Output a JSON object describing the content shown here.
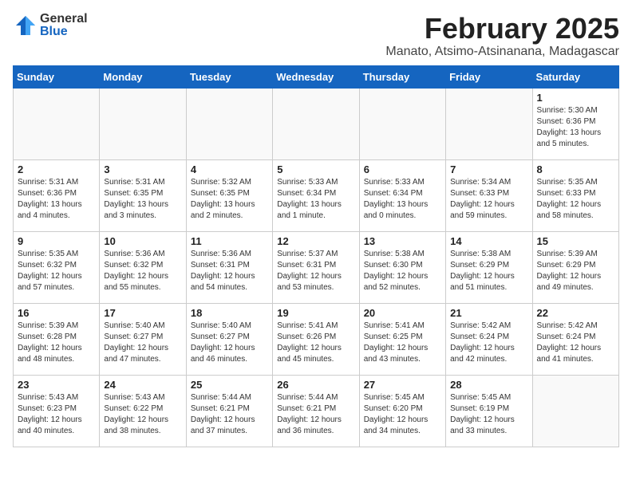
{
  "logo": {
    "general": "General",
    "blue": "Blue"
  },
  "title": "February 2025",
  "location": "Manato, Atsimo-Atsinanana, Madagascar",
  "weekdays": [
    "Sunday",
    "Monday",
    "Tuesday",
    "Wednesday",
    "Thursday",
    "Friday",
    "Saturday"
  ],
  "weeks": [
    [
      {
        "day": "",
        "info": ""
      },
      {
        "day": "",
        "info": ""
      },
      {
        "day": "",
        "info": ""
      },
      {
        "day": "",
        "info": ""
      },
      {
        "day": "",
        "info": ""
      },
      {
        "day": "",
        "info": ""
      },
      {
        "day": "1",
        "info": "Sunrise: 5:30 AM\nSunset: 6:36 PM\nDaylight: 13 hours\nand 5 minutes."
      }
    ],
    [
      {
        "day": "2",
        "info": "Sunrise: 5:31 AM\nSunset: 6:36 PM\nDaylight: 13 hours\nand 4 minutes."
      },
      {
        "day": "3",
        "info": "Sunrise: 5:31 AM\nSunset: 6:35 PM\nDaylight: 13 hours\nand 3 minutes."
      },
      {
        "day": "4",
        "info": "Sunrise: 5:32 AM\nSunset: 6:35 PM\nDaylight: 13 hours\nand 2 minutes."
      },
      {
        "day": "5",
        "info": "Sunrise: 5:33 AM\nSunset: 6:34 PM\nDaylight: 13 hours\nand 1 minute."
      },
      {
        "day": "6",
        "info": "Sunrise: 5:33 AM\nSunset: 6:34 PM\nDaylight: 13 hours\nand 0 minutes."
      },
      {
        "day": "7",
        "info": "Sunrise: 5:34 AM\nSunset: 6:33 PM\nDaylight: 12 hours\nand 59 minutes."
      },
      {
        "day": "8",
        "info": "Sunrise: 5:35 AM\nSunset: 6:33 PM\nDaylight: 12 hours\nand 58 minutes."
      }
    ],
    [
      {
        "day": "9",
        "info": "Sunrise: 5:35 AM\nSunset: 6:32 PM\nDaylight: 12 hours\nand 57 minutes."
      },
      {
        "day": "10",
        "info": "Sunrise: 5:36 AM\nSunset: 6:32 PM\nDaylight: 12 hours\nand 55 minutes."
      },
      {
        "day": "11",
        "info": "Sunrise: 5:36 AM\nSunset: 6:31 PM\nDaylight: 12 hours\nand 54 minutes."
      },
      {
        "day": "12",
        "info": "Sunrise: 5:37 AM\nSunset: 6:31 PM\nDaylight: 12 hours\nand 53 minutes."
      },
      {
        "day": "13",
        "info": "Sunrise: 5:38 AM\nSunset: 6:30 PM\nDaylight: 12 hours\nand 52 minutes."
      },
      {
        "day": "14",
        "info": "Sunrise: 5:38 AM\nSunset: 6:29 PM\nDaylight: 12 hours\nand 51 minutes."
      },
      {
        "day": "15",
        "info": "Sunrise: 5:39 AM\nSunset: 6:29 PM\nDaylight: 12 hours\nand 49 minutes."
      }
    ],
    [
      {
        "day": "16",
        "info": "Sunrise: 5:39 AM\nSunset: 6:28 PM\nDaylight: 12 hours\nand 48 minutes."
      },
      {
        "day": "17",
        "info": "Sunrise: 5:40 AM\nSunset: 6:27 PM\nDaylight: 12 hours\nand 47 minutes."
      },
      {
        "day": "18",
        "info": "Sunrise: 5:40 AM\nSunset: 6:27 PM\nDaylight: 12 hours\nand 46 minutes."
      },
      {
        "day": "19",
        "info": "Sunrise: 5:41 AM\nSunset: 6:26 PM\nDaylight: 12 hours\nand 45 minutes."
      },
      {
        "day": "20",
        "info": "Sunrise: 5:41 AM\nSunset: 6:25 PM\nDaylight: 12 hours\nand 43 minutes."
      },
      {
        "day": "21",
        "info": "Sunrise: 5:42 AM\nSunset: 6:24 PM\nDaylight: 12 hours\nand 42 minutes."
      },
      {
        "day": "22",
        "info": "Sunrise: 5:42 AM\nSunset: 6:24 PM\nDaylight: 12 hours\nand 41 minutes."
      }
    ],
    [
      {
        "day": "23",
        "info": "Sunrise: 5:43 AM\nSunset: 6:23 PM\nDaylight: 12 hours\nand 40 minutes."
      },
      {
        "day": "24",
        "info": "Sunrise: 5:43 AM\nSunset: 6:22 PM\nDaylight: 12 hours\nand 38 minutes."
      },
      {
        "day": "25",
        "info": "Sunrise: 5:44 AM\nSunset: 6:21 PM\nDaylight: 12 hours\nand 37 minutes."
      },
      {
        "day": "26",
        "info": "Sunrise: 5:44 AM\nSunset: 6:21 PM\nDaylight: 12 hours\nand 36 minutes."
      },
      {
        "day": "27",
        "info": "Sunrise: 5:45 AM\nSunset: 6:20 PM\nDaylight: 12 hours\nand 34 minutes."
      },
      {
        "day": "28",
        "info": "Sunrise: 5:45 AM\nSunset: 6:19 PM\nDaylight: 12 hours\nand 33 minutes."
      },
      {
        "day": "",
        "info": ""
      }
    ]
  ]
}
